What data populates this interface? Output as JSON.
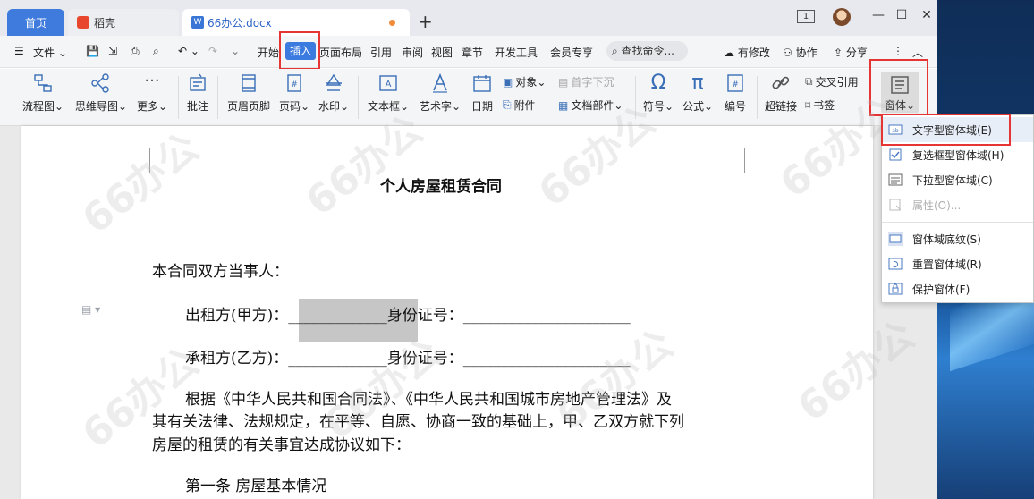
{
  "tabs": {
    "home": "首页",
    "daoke": "稻壳",
    "doc": "66办公.docx"
  },
  "title_bar": {
    "page_indicator": "1"
  },
  "menu": {
    "file": "文件",
    "items": [
      "开始",
      "插入",
      "页面布局",
      "引用",
      "审阅",
      "视图",
      "章节",
      "开发工具",
      "会员专享"
    ],
    "search": "查找命令...",
    "modified": "有修改",
    "collab": "协作",
    "share": "分享"
  },
  "ribbon": {
    "flowchart": "流程图",
    "mindmap": "思维导图",
    "more": "更多",
    "annotation": "批注",
    "header_footer": "页眉页脚",
    "page_number": "页码",
    "watermark": "水印",
    "textbox": "文本框",
    "wordart": "艺术字",
    "date": "日期",
    "object": "对象",
    "attachment": "附件",
    "dropcap": "首字下沉",
    "doc_parts": "文档部件",
    "symbol": "符号",
    "formula": "公式",
    "numbering": "编号",
    "hyperlink": "超链接",
    "cross_ref": "交叉引用",
    "bookmark": "书签",
    "form": "窗体"
  },
  "dropdown": {
    "items": [
      {
        "label": "文字型窗体域(E)",
        "enabled": true
      },
      {
        "label": "复选框型窗体域(H)",
        "enabled": true
      },
      {
        "label": "下拉型窗体域(C)",
        "enabled": true
      },
      {
        "label": "属性(O)...",
        "enabled": false
      },
      {
        "label": "窗体域底纹(S)",
        "enabled": true
      },
      {
        "label": "重置窗体域(R)",
        "enabled": true
      },
      {
        "label": "保护窗体(F)",
        "enabled": true
      }
    ]
  },
  "document": {
    "title": "个人房屋租赁合同",
    "line1": "本合同双方当事人：",
    "line2": "出租方(甲方)：_____________身份证号：______________________",
    "line3": "承租方(乙方)：_____________身份证号：______________________",
    "para1": "根据《中华人民共和国合同法》、《中华人民共和国城市房地产管理法》及",
    "para2": "其有关法律、法规规定，在平等、自愿、协商一致的基础上，甲、乙双方就下列",
    "para3": "房屋的租赁的有关事宜达成协议如下：",
    "section1": "第一条  房屋基本情况"
  },
  "watermark_text": "66办公",
  "colors": {
    "accent": "#3b7be0",
    "highlight_box": "#e53535"
  }
}
